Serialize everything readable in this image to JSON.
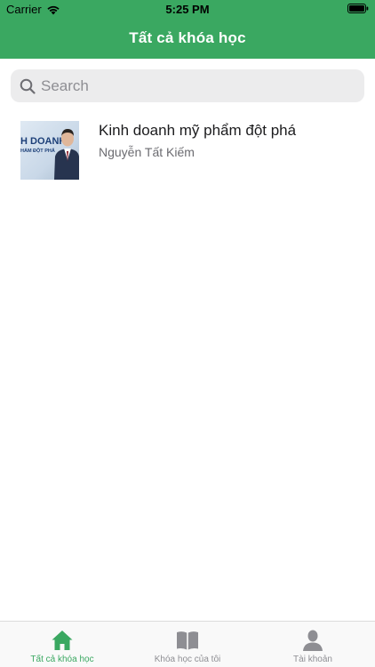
{
  "status_bar": {
    "carrier": "Carrier",
    "time": "5:25 PM",
    "wifi_icon": "wifi-icon",
    "battery_icon": "battery-icon"
  },
  "nav": {
    "title": "Tất cả khóa học"
  },
  "search": {
    "placeholder": "Search",
    "value": "",
    "icon": "search-icon"
  },
  "courses": [
    {
      "title": "Kinh doanh mỹ phẩm đột phá",
      "author": "Nguyễn Tất Kiếm",
      "thumbnail": {
        "line1": "H DOANH",
        "line2": "HẨM ĐỘT PHÁ"
      }
    }
  ],
  "tabs": [
    {
      "label": "Tất cả khóa học",
      "icon": "home-icon",
      "active": true
    },
    {
      "label": "Khóa học của tôi",
      "icon": "book-icon",
      "active": false
    },
    {
      "label": "Tài khoản",
      "icon": "user-icon",
      "active": false
    }
  ],
  "colors": {
    "accent": "#3aa861",
    "inactive": "#8e8e93"
  }
}
